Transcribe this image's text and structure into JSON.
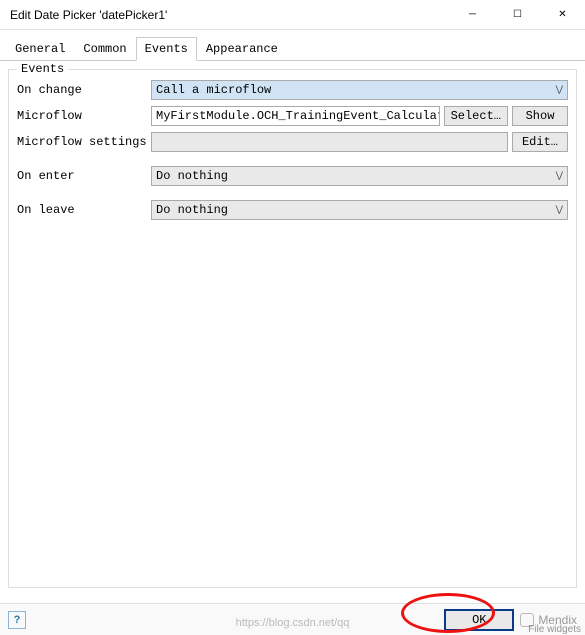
{
  "window": {
    "title": "Edit Date Picker 'datePicker1'"
  },
  "tabs": {
    "general": "General",
    "common": "Common",
    "events": "Events",
    "appearance": "Appearance",
    "active": "events"
  },
  "events": {
    "legend": "Events",
    "onChange": {
      "label": "On change",
      "value": "Call a microflow"
    },
    "microflow": {
      "label": "Microflow",
      "value": "MyFirstModule.OCH_TrainingEvent_CalculateEn",
      "selectBtn": "Select…",
      "showBtn": "Show"
    },
    "microflowSettings": {
      "label": "Microflow settings",
      "value": "",
      "editBtn": "Edit…"
    },
    "onEnter": {
      "label": "On enter",
      "value": "Do nothing"
    },
    "onLeave": {
      "label": "On leave",
      "value": "Do nothing"
    }
  },
  "footer": {
    "ok": "OK",
    "brand": "Mendix"
  },
  "watermark": "https://blog.csdn.net/qq",
  "bgtext": "File widgets"
}
